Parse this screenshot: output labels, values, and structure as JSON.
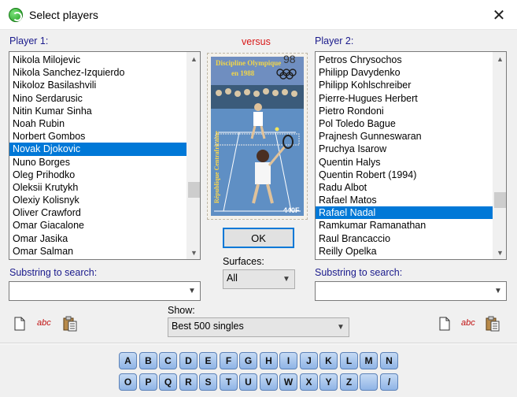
{
  "window": {
    "title": "Select players",
    "close_glyph": "✕"
  },
  "left": {
    "label": "Player 1:",
    "players": [
      "Nikola Milojevic",
      "Nikola Sanchez-Izquierdo",
      "Nikoloz Basilashvili",
      "Nino Serdarusic",
      "Nitin Kumar Sinha",
      "Noah Rubin",
      "Norbert Gombos",
      "Novak Djokovic",
      "Nuno Borges",
      "Oleg Prihodko",
      "Oleksii Krutykh",
      "Olexiy Kolisnyk",
      "Oliver Crawford",
      "Omar Giacalone",
      "Omar Jasika",
      "Omar Salman"
    ],
    "selected": "Novak Djokovic",
    "search_label": "Substring to search:",
    "search_value": ""
  },
  "center": {
    "versus": "versus",
    "ok_label": "OK",
    "surfaces_label": "Surfaces:",
    "surfaces_value": "All",
    "stamp": {
      "banner_line1": "Discipline Olympique",
      "banner_line2": "en 1988",
      "country": "République Centrafricaine",
      "value": "440F",
      "postmark": "98"
    }
  },
  "right": {
    "label": "Player 2:",
    "players": [
      "Petros Chrysochos",
      "Philipp Davydenko",
      "Philipp Kohlschreiber",
      "Pierre-Hugues Herbert",
      "Pietro Rondoni",
      "Pol Toledo Bague",
      "Prajnesh Gunneswaran",
      "Pruchya Isarow",
      "Quentin Halys",
      "Quentin Robert (1994)",
      "Radu Albot",
      "Rafael Matos",
      "Rafael Nadal",
      "Ramkumar Ramanathan",
      "Raul Brancaccio",
      "Reilly Opelka"
    ],
    "selected": "Rafael Nadal",
    "search_label": "Substring to search:",
    "search_value": ""
  },
  "show": {
    "label": "Show:",
    "value": "Best 500 singles"
  },
  "tools": {
    "new_icon": "new-document-icon",
    "abc_label": "abc",
    "paste_icon": "clipboard-icon"
  },
  "letters_row1": [
    "A",
    "B",
    "C",
    "D",
    "E",
    "F",
    "G",
    "H",
    "I",
    "J",
    "K",
    "L",
    "M",
    "N"
  ],
  "letters_row2": [
    "O",
    "P",
    "Q",
    "R",
    "S",
    "T",
    "U",
    "V",
    "W",
    "X",
    "Y",
    "Z",
    "",
    "/"
  ],
  "colors": {
    "selection": "#0078d7",
    "label_blue": "#1a1a8c",
    "versus_red": "#d81818",
    "letter_btn": "#a9c6ee"
  }
}
